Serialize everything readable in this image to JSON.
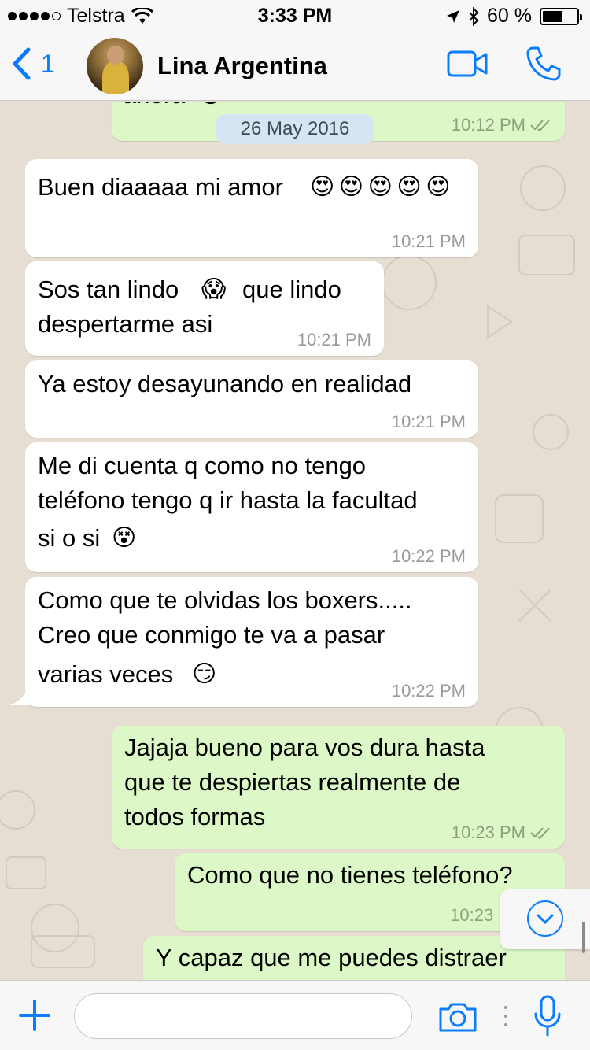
{
  "status_bar": {
    "carrier": "Telstra",
    "time": "3:33 PM",
    "battery": "60 %",
    "battery_level": 0.6
  },
  "nav": {
    "back_count": "1",
    "contact_name": "Lina Argentina"
  },
  "chat": {
    "date_pill": "26 May 2016",
    "partial_top": {
      "text": "ahora",
      "emoji": "😈",
      "time": "10:12 PM"
    },
    "messages": [
      {
        "text": "Buen diaaaaa mi amor",
        "emoji": "😍 😍 😍 😍 😍",
        "time": "10:21 PM"
      },
      {
        "text": "Sos tan lindo",
        "emoji": "😱",
        "text2": "que lindo",
        "text3": "despertarme asi",
        "time": "10:21 PM"
      },
      {
        "text": "Ya estoy desayunando en realidad",
        "time": "10:21 PM"
      },
      {
        "line1": "Me di cuenta q como no tengo",
        "line2": "teléfono tengo q ir hasta la facultad",
        "line3": "si o si",
        "emoji": "😵",
        "time": "10:22 PM"
      },
      {
        "line1": "Como que te olvidas los boxers.....",
        "line2": "Creo que conmigo te va a pasar",
        "line3": "varias veces",
        "emoji": "😏",
        "time": "10:22 PM"
      },
      {
        "line1": "Jajaja bueno para vos dura hasta",
        "line2": "que te despiertas realmente de",
        "line3": "todos formas",
        "time": "10:23 PM"
      },
      {
        "text": "Como que no tienes teléfono?",
        "time": "10:23 P"
      },
      {
        "text": "Y capaz que me puedes distraer"
      }
    ]
  },
  "input": {
    "placeholder": ""
  },
  "icons": {
    "back": "chevron-left-icon",
    "video": "video-camera-icon",
    "call": "phone-icon",
    "plus": "plus-icon",
    "camera": "camera-icon",
    "mic": "microphone-icon",
    "scroll_down": "chevron-down-icon",
    "read_receipt": "double-check-icon"
  },
  "colors": {
    "accent": "#0a7cff",
    "outgoing_bubble": "#dcf8c6",
    "incoming_bubble": "#ffffff",
    "date_pill": "#d7e4f4"
  }
}
